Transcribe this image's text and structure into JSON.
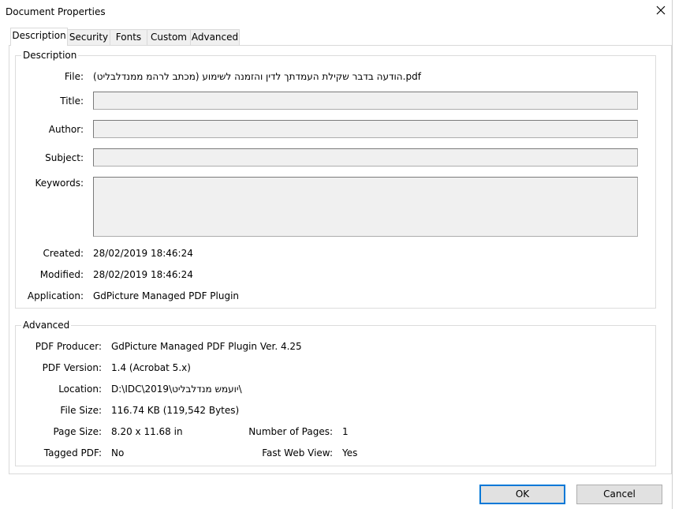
{
  "window": {
    "title": "Document Properties",
    "close_icon": "close-icon"
  },
  "tabs": [
    {
      "label": "Description",
      "active": true
    },
    {
      "label": "Security",
      "active": false
    },
    {
      "label": "Fonts",
      "active": false
    },
    {
      "label": "Custom",
      "active": false
    },
    {
      "label": "Advanced",
      "active": false
    }
  ],
  "description": {
    "group_title": "Description",
    "file_label": "File:",
    "file_value": "(מכתב לרהמ ממנדלבליט) הודעה בדבר שקילת העמדתך לדין והזמנה לשימוע.pdf",
    "title_label": "Title:",
    "title_value": "",
    "author_label": "Author:",
    "author_value": "",
    "subject_label": "Subject:",
    "subject_value": "",
    "keywords_label": "Keywords:",
    "keywords_value": "",
    "created_label": "Created:",
    "created_value": "28/02/2019 18:46:24",
    "modified_label": "Modified:",
    "modified_value": "28/02/2019 18:46:24",
    "application_label": "Application:",
    "application_value": "GdPicture Managed PDF Plugin"
  },
  "advanced": {
    "group_title": "Advanced",
    "pdf_producer_label": "PDF Producer:",
    "pdf_producer_value": "GdPicture Managed PDF Plugin Ver. 4.25",
    "pdf_version_label": "PDF Version:",
    "pdf_version_value": "1.4 (Acrobat 5.x)",
    "location_label": "Location:",
    "location_value": "D:\\IDC\\2019\\יועמש מנדלבליט\\",
    "file_size_label": "File Size:",
    "file_size_value": "116.74 KB (119,542 Bytes)",
    "page_size_label": "Page Size:",
    "page_size_value": "8.20 x 11.68 in",
    "num_pages_label": "Number of Pages:",
    "num_pages_value": "1",
    "tagged_pdf_label": "Tagged PDF:",
    "tagged_pdf_value": "No",
    "fast_web_view_label": "Fast Web View:",
    "fast_web_view_value": "Yes"
  },
  "buttons": {
    "ok": "OK",
    "cancel": "Cancel"
  }
}
